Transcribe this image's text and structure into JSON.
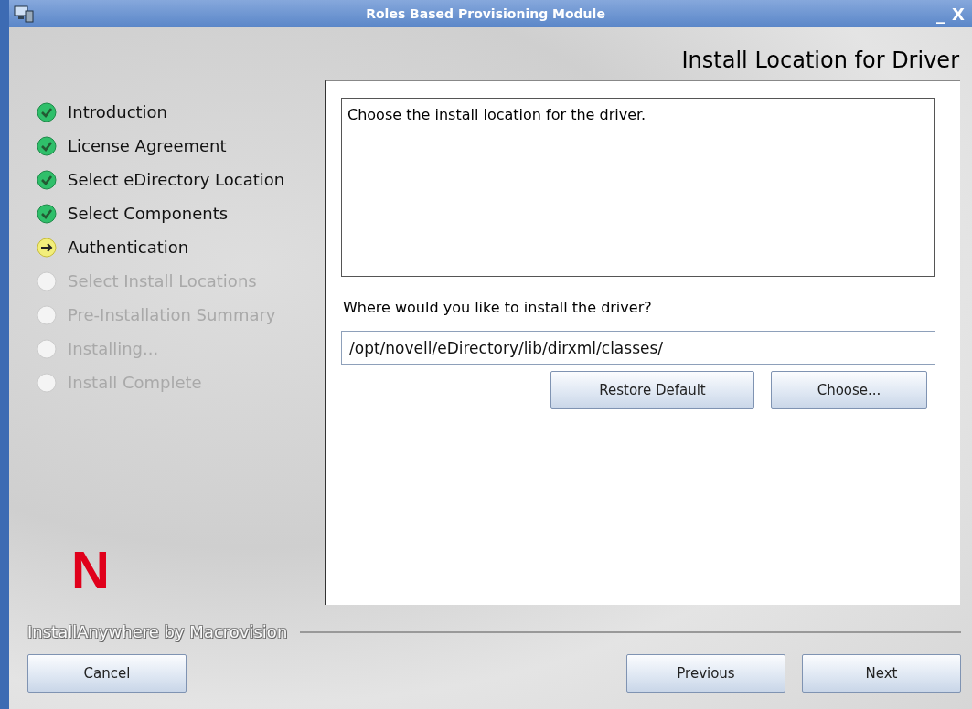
{
  "window": {
    "title": "Roles Based Provisioning Module",
    "controls": [
      "_",
      "X"
    ]
  },
  "header": {
    "title": "Install Location for Driver"
  },
  "steps": [
    {
      "label": "Introduction",
      "kind": "done"
    },
    {
      "label": "License Agreement",
      "kind": "done"
    },
    {
      "label": "Select eDirectory Location",
      "kind": "done"
    },
    {
      "label": "Select Components",
      "kind": "done"
    },
    {
      "label": "Authentication",
      "kind": "current"
    },
    {
      "label": "Select Install Locations",
      "kind": "pending"
    },
    {
      "label": "Pre-Installation Summary",
      "kind": "pending"
    },
    {
      "label": "Installing...",
      "kind": "pending"
    },
    {
      "label": "Install Complete",
      "kind": "pending"
    }
  ],
  "logo": {
    "text": "N"
  },
  "content": {
    "description": "Choose the install location for the driver.",
    "question": "Where would you like to install the driver?",
    "path": {
      "value": "/opt/novell/eDirectory/lib/dirxml/classes/"
    },
    "buttons": [
      "Restore Default",
      "Choose..."
    ]
  },
  "footer": {
    "brand": "InstallAnywhere by Macrovision",
    "buttons": [
      {
        "label": "Cancel",
        "kind": "cancel"
      },
      {
        "label": "Previous",
        "kind": "nav"
      },
      {
        "label": "Next",
        "kind": "nav"
      }
    ]
  }
}
